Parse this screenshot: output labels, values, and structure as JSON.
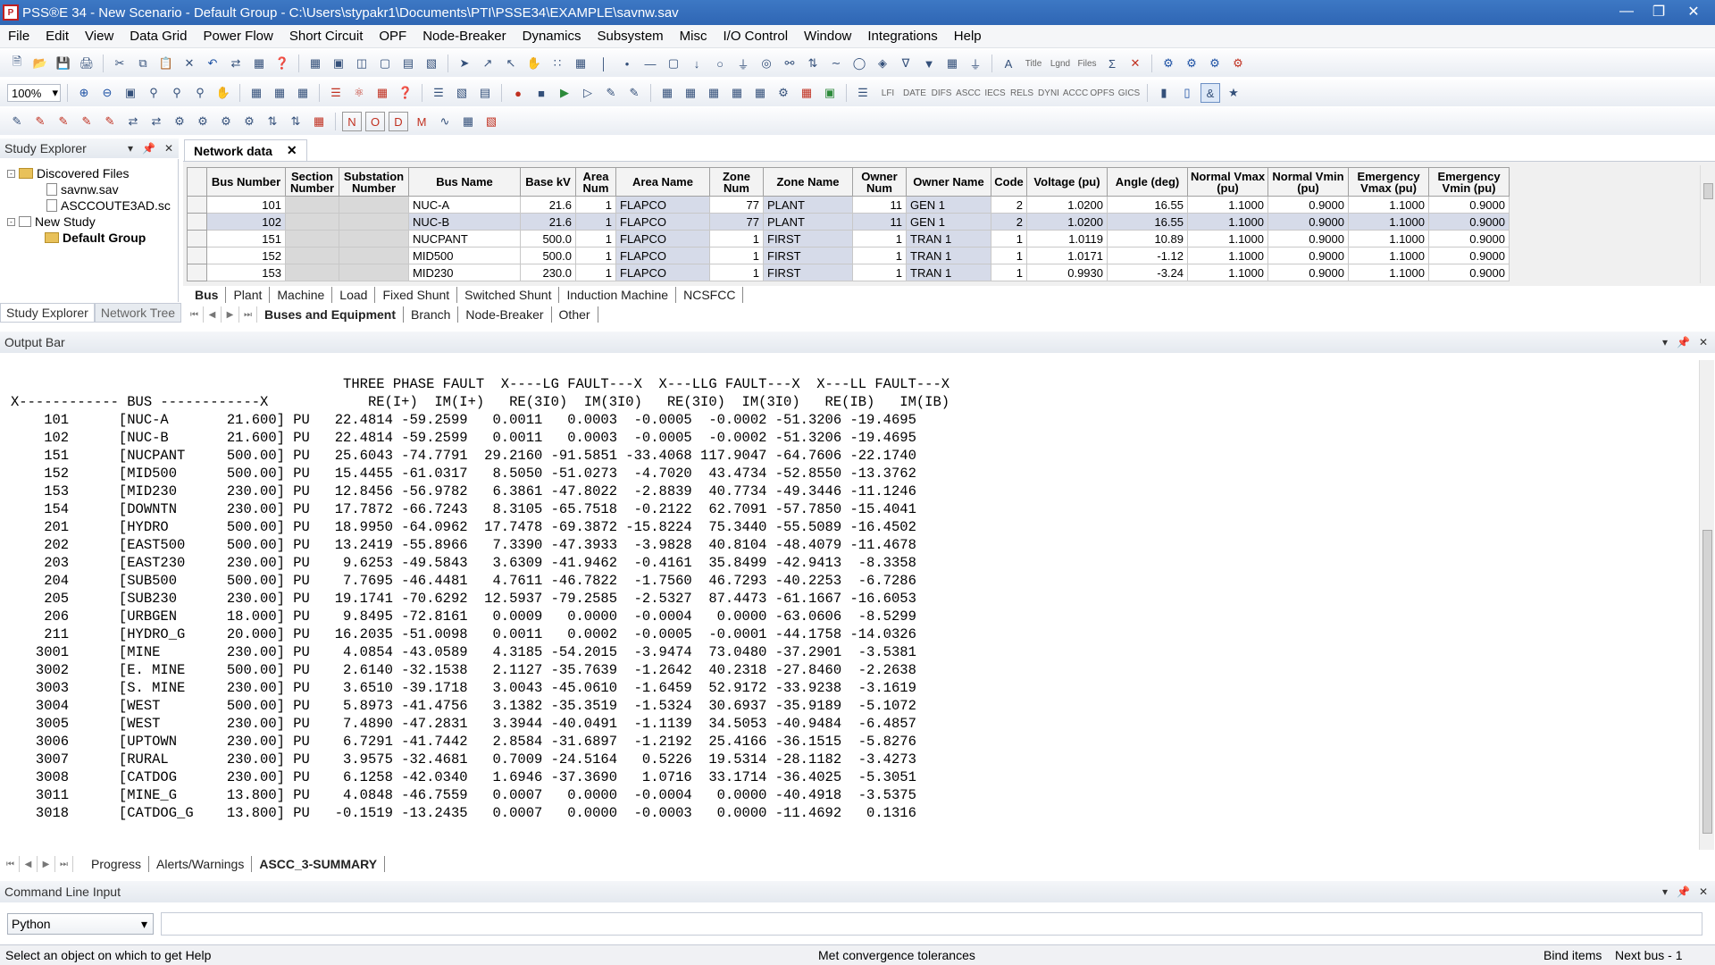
{
  "window": {
    "title": "PSS®E 34 - New Scenario - Default Group - C:\\Users\\stypakr1\\Documents\\PTI\\PSSE34\\EXAMPLE\\savnw.sav"
  },
  "menu": [
    "File",
    "Edit",
    "View",
    "Data Grid",
    "Power Flow",
    "Short Circuit",
    "OPF",
    "Node-Breaker",
    "Dynamics",
    "Subsystem",
    "Misc",
    "I/O Control",
    "Window",
    "Integrations",
    "Help"
  ],
  "toolbar": {
    "zoom_value": "100%",
    "text_buttons_row2": [
      "LFI",
      "DATE",
      "DIFS",
      "ASCC",
      "IECS",
      "RELS",
      "DYNI",
      "ACCC",
      "OPFS",
      "GICS"
    ],
    "text_buttons_row1": [
      "Title",
      "Lgnd",
      "Files"
    ]
  },
  "study_explorer": {
    "title": "Study Explorer",
    "items": [
      "Discovered Files",
      "savnw.sav",
      "ASCCOUTE3AD.sc",
      "New Study",
      "Default Group"
    ],
    "tabs": [
      "Study Explorer",
      "Network Tree"
    ]
  },
  "network_data": {
    "tab_label": "Network data",
    "headers": [
      "Bus Number",
      "Section Number",
      "Substation Number",
      "Bus Name",
      "Base kV",
      "Area Num",
      "Area Name",
      "Zone Num",
      "Zone Name",
      "Owner Num",
      "Owner Name",
      "Code",
      "Voltage (pu)",
      "Angle (deg)",
      "Normal Vmax (pu)",
      "Normal Vmin (pu)",
      "Emergency Vmax (pu)",
      "Emergency Vmin (pu)"
    ],
    "rows": [
      [
        "101",
        "",
        "",
        "NUC-A",
        "21.6",
        "1",
        "FLAPCO",
        "77",
        "PLANT",
        "11",
        "GEN 1",
        "2",
        "1.0200",
        "16.55",
        "1.1000",
        "0.9000",
        "1.1000",
        "0.9000"
      ],
      [
        "102",
        "",
        "",
        "NUC-B",
        "21.6",
        "1",
        "FLAPCO",
        "77",
        "PLANT",
        "11",
        "GEN 1",
        "2",
        "1.0200",
        "16.55",
        "1.1000",
        "0.9000",
        "1.1000",
        "0.9000"
      ],
      [
        "151",
        "",
        "",
        "NUCPANT",
        "500.0",
        "1",
        "FLAPCO",
        "1",
        "FIRST",
        "1",
        "TRAN 1",
        "1",
        "1.0119",
        "10.89",
        "1.1000",
        "0.9000",
        "1.1000",
        "0.9000"
      ],
      [
        "152",
        "",
        "",
        "MID500",
        "500.0",
        "1",
        "FLAPCO",
        "1",
        "FIRST",
        "1",
        "TRAN 1",
        "1",
        "1.0171",
        "-1.12",
        "1.1000",
        "0.9000",
        "1.1000",
        "0.9000"
      ],
      [
        "153",
        "",
        "",
        "MID230",
        "230.0",
        "1",
        "FLAPCO",
        "1",
        "FIRST",
        "1",
        "TRAN 1",
        "1",
        "0.9930",
        "-3.24",
        "1.1000",
        "0.9000",
        "1.1000",
        "0.9000"
      ]
    ],
    "element_tabs": [
      "Bus",
      "Plant",
      "Machine",
      "Load",
      "Fixed Shunt",
      "Switched Shunt",
      "Induction Machine",
      "NCSFCC"
    ],
    "category_tabs": [
      "Buses and Equipment",
      "Branch",
      "Node-Breaker",
      "Other"
    ]
  },
  "output_bar": {
    "title": "Output Bar",
    "lines": [
      "                                        THREE PHASE FAULT  X----LG FAULT---X  X---LLG FAULT---X  X---LL FAULT---X",
      "X------------ BUS ------------X            RE(I+)  IM(I+)   RE(3I0)  IM(3I0)   RE(3I0)  IM(3I0)   RE(IB)   IM(IB)",
      "    101      [NUC-A       21.600] PU   22.4814 -59.2599   0.0011   0.0003  -0.0005  -0.0002 -51.3206 -19.4695",
      "    102      [NUC-B       21.600] PU   22.4814 -59.2599   0.0011   0.0003  -0.0005  -0.0002 -51.3206 -19.4695",
      "    151      [NUCPANT     500.00] PU   25.6043 -74.7791  29.2160 -91.5851 -33.4068 117.9047 -64.7606 -22.1740",
      "    152      [MID500      500.00] PU   15.4455 -61.0317   8.5050 -51.0273  -4.7020  43.4734 -52.8550 -13.3762",
      "    153      [MID230      230.00] PU   12.8456 -56.9782   6.3861 -47.8022  -2.8839  40.7734 -49.3446 -11.1246",
      "    154      [DOWNTN      230.00] PU   17.7872 -66.7243   8.3105 -65.7518  -0.2122  62.7091 -57.7850 -15.4041",
      "    201      [HYDRO       500.00] PU   18.9950 -64.0962  17.7478 -69.3872 -15.8224  75.3440 -55.5089 -16.4502",
      "    202      [EAST500     500.00] PU   13.2419 -55.8966   7.3390 -47.3933  -3.9828  40.8104 -48.4079 -11.4678",
      "    203      [EAST230     230.00] PU    9.6253 -49.5843   3.6309 -41.9462  -0.4161  35.8499 -42.9413  -8.3358",
      "    204      [SUB500      500.00] PU    7.7695 -46.4481   4.7611 -46.7822  -1.7560  46.7293 -40.2253  -6.7286",
      "    205      [SUB230      230.00] PU   19.1741 -70.6292  12.5937 -79.2585  -2.5327  87.4473 -61.1667 -16.6053",
      "    206      [URBGEN      18.000] PU    9.8495 -72.8161   0.0009   0.0000  -0.0004   0.0000 -63.0606  -8.5299",
      "    211      [HYDRO_G     20.000] PU   16.2035 -51.0098   0.0011   0.0002  -0.0005  -0.0001 -44.1758 -14.0326",
      "   3001      [MINE        230.00] PU    4.0854 -43.0589   4.3185 -54.2015  -3.9474  73.0480 -37.2901  -3.5381",
      "   3002      [E. MINE     500.00] PU    2.6140 -32.1538   2.1127 -35.7639  -1.2642  40.2318 -27.8460  -2.2638",
      "   3003      [S. MINE     230.00] PU    3.6510 -39.1718   3.0043 -45.0610  -1.6459  52.9172 -33.9238  -3.1619",
      "   3004      [WEST        500.00] PU    5.8973 -41.4756   3.1382 -35.3519  -1.5324  30.6937 -35.9189  -5.1072",
      "   3005      [WEST        230.00] PU    7.4890 -47.2831   3.3944 -40.0491  -1.1139  34.5053 -40.9484  -6.4857",
      "   3006      [UPTOWN      230.00] PU    6.7291 -41.7442   2.8584 -31.6897  -1.2192  25.4166 -36.1515  -5.8276",
      "   3007      [RURAL       230.00] PU    3.9575 -32.4681   0.7009 -24.5164   0.5226  19.5314 -28.1182  -3.4273",
      "   3008      [CATDOG      230.00] PU    6.1258 -42.0340   1.6946 -37.3690   1.0716  33.1714 -36.4025  -5.3051",
      "   3011      [MINE_G      13.800] PU    4.0848 -46.7559   0.0007   0.0000  -0.0004   0.0000 -40.4918  -3.5375",
      "   3018      [CATDOG_G    13.800] PU   -0.1519 -13.2435   0.0007   0.0000  -0.0003   0.0000 -11.4692   0.1316"
    ],
    "tabs": [
      "Progress",
      "Alerts/Warnings",
      "ASCC_3-SUMMARY"
    ]
  },
  "command_line": {
    "title": "Command Line Input",
    "language": "Python",
    "value": ""
  },
  "status": {
    "left": "Select an object on which to get Help",
    "center": "Met convergence tolerances",
    "bind": "Bind items",
    "next_bus": "Next bus - 1"
  }
}
